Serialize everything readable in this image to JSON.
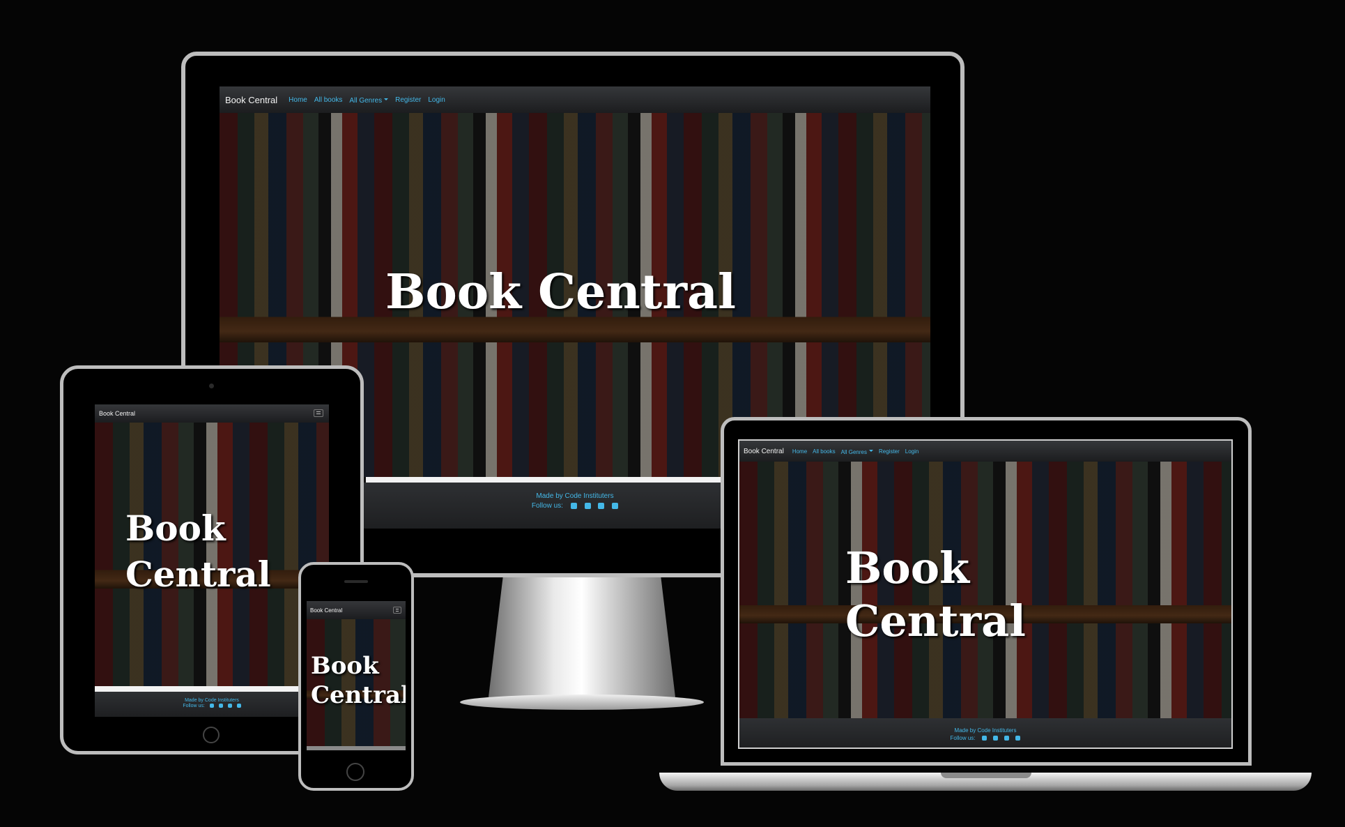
{
  "site": {
    "brand": "Book Central",
    "hero_title": "Book Central",
    "hero_line1": "Book",
    "hero_line2": "Central",
    "nav": {
      "home": "Home",
      "all_books": "All books",
      "all_genres": "All Genres",
      "register": "Register",
      "login": "Login"
    },
    "footer": {
      "made_by": "Made by Code Instituters",
      "follow_us": "Follow us:"
    },
    "social_icons": [
      "facebook-icon",
      "twitter-icon",
      "instagram-icon",
      "youtube-icon"
    ]
  },
  "colors": {
    "background": "#050505",
    "nav_link": "#44b8e8",
    "navbar": "#2a2b2e",
    "footer": "#26282a"
  }
}
